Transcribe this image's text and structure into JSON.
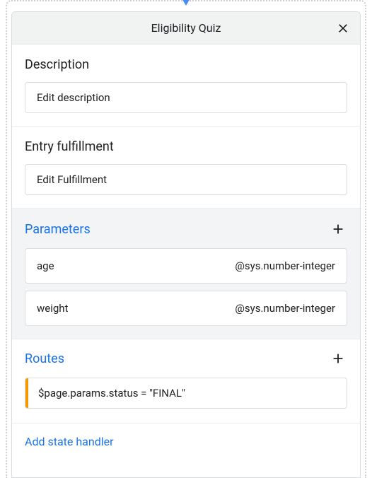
{
  "header": {
    "title": "Eligibility Quiz"
  },
  "description": {
    "heading": "Description",
    "button_label": "Edit description"
  },
  "entry_fulfillment": {
    "heading": "Entry fulfillment",
    "button_label": "Edit Fulfillment"
  },
  "parameters": {
    "heading": "Parameters",
    "rows": [
      {
        "name": "age",
        "type": "@sys.number-integer"
      },
      {
        "name": "weight",
        "type": "@sys.number-integer"
      }
    ]
  },
  "routes": {
    "heading": "Routes",
    "rows": [
      {
        "condition": "$page.params.status = \"FINAL\""
      }
    ]
  },
  "add_state_handler": {
    "label": "Add state handler"
  }
}
